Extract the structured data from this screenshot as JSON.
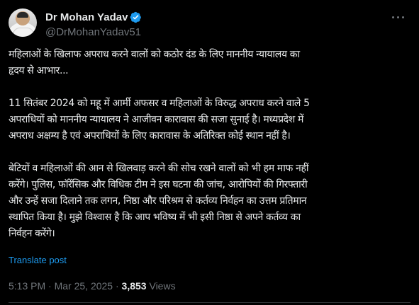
{
  "author": {
    "display_name": "Dr Mohan Yadav",
    "handle": "@DrMohanYadav51",
    "verified_color": "#1d9bf0",
    "avatar_icon": "avatar-photo"
  },
  "tweet": {
    "lines": [
      "महिलाओं के खिलाफ अपराध करने वालों को कठोर दंड के लिए माननीय न्यायालय का",
      "हृदय से आभार...",
      "",
      "11 सितंबर 2024 को महू में आर्मी अफसर व महिलाओं के विरुद्ध अपराध करने वाले 5",
      "अपराधियों को माननीय न्यायालय ने आजीवन कारावास की सजा सुनाई है। मध्यप्रदेश में",
      "अपराध अक्षम्य है एवं अपराधियों के लिए कारावास के अतिरिक्त कोई स्थान नहीं है।",
      "",
      "बेटियों व महिलाओं की आन से खिलवाड़ करने की सोच रखने वालों को भी हम माफ नहीं",
      "करेंगे। पुलिस, फॉरेंसिक और विधिक टीम ने इस घटना की जांच, आरोपियों की गिरफ्तारी",
      "और उन्हें सजा दिलाने तक लगन, निष्ठा और परिश्रम से कर्तव्य निर्वहन का उत्तम प्रतिमान",
      "स्थापित किया है। मुझे विश्वास है कि आप भविष्य में भी इसी निष्ठा से अपने कर्तव्य का",
      "निर्वहन करेंगे।"
    ],
    "translate_label": "Translate post",
    "time": "5:13 PM",
    "separator": "·",
    "date": "Mar 25, 2025",
    "views_count": "3,853",
    "views_label": "Views"
  },
  "colors": {
    "background": "#000000",
    "text": "#e7e9ea",
    "muted": "#71767b",
    "link": "#1d9bf0"
  }
}
